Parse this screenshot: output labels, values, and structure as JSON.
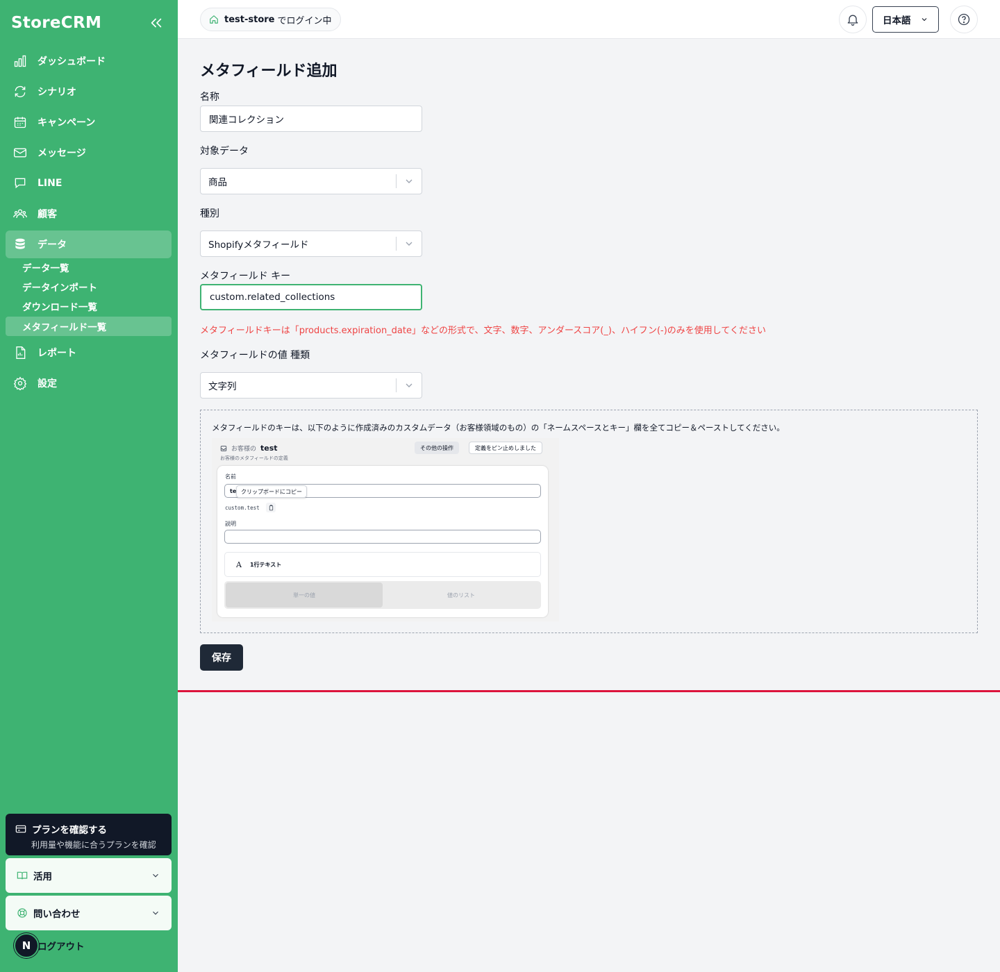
{
  "sidebar": {
    "brand": "StoreCRM",
    "items": [
      {
        "label": "ダッシュボード",
        "icon": "bar-chart-icon"
      },
      {
        "label": "シナリオ",
        "icon": "refresh-icon"
      },
      {
        "label": "キャンペーン",
        "icon": "calendar-icon"
      },
      {
        "label": "メッセージ",
        "icon": "mail-icon"
      },
      {
        "label": "LINE",
        "icon": "chat-icon"
      },
      {
        "label": "顧客",
        "icon": "users-icon"
      },
      {
        "label": "データ",
        "icon": "database-icon",
        "active": true
      },
      {
        "label": "レポート",
        "icon": "report-icon"
      },
      {
        "label": "設定",
        "icon": "gear-icon"
      }
    ],
    "sub_items": [
      {
        "label": "データ一覧"
      },
      {
        "label": "データインポート"
      },
      {
        "label": "ダウンロード一覧"
      },
      {
        "label": "メタフィールド一覧",
        "active": true
      }
    ],
    "plan": {
      "title": "プランを確認する",
      "subtitle": "利用量や機能に合うプランを確認"
    },
    "accordions": [
      {
        "label": "活用",
        "icon": "book-icon"
      },
      {
        "label": "問い合わせ",
        "icon": "lifebuoy-icon"
      }
    ],
    "logout": "ログアウト",
    "avatar_letter": "N"
  },
  "topbar": {
    "store_name": "test-store",
    "store_status": "でログイン中",
    "language": "日本語"
  },
  "form": {
    "title": "メタフィールド追加",
    "name_label": "名称",
    "name_value": "関連コレクション",
    "target_label": "対象データ",
    "target_value": "商品",
    "type_label": "種別",
    "type_value": "Shopifyメタフィールド",
    "key_label": "メタフィールド キー",
    "key_value": "custom.related_collections",
    "key_error": "メタフィールドキーは「products.expiration_date」などの形式で、文字、数字、アンダースコア(_)、ハイフン(-)のみを使用してください",
    "value_type_label": "メタフィールドの値 種類",
    "value_type_value": "文字列",
    "hint": "メタフィールドのキーは、以下のように作成済みのカスタムデータ（お客様領域のもの）の「ネームスペースとキー」欄を全てコピー＆ペーストしてください。",
    "save_label": "保存"
  },
  "example": {
    "crumb": "お客様の",
    "crumb_current": "test",
    "crumb_sub": "お客様のメタフィールドの定義",
    "other_actions": "その他の操作",
    "pinned": "定義をピン止めしました",
    "name_label": "名前",
    "name_prefix": "te",
    "tooltip": "クリップボードにコピー",
    "key": "custom.test",
    "desc_label": "説明",
    "type_label": "1行テキスト",
    "single_value": "単一の値",
    "list_value": "値のリスト"
  },
  "colors": {
    "sidebar": "#3eb372",
    "error": "#ef4444",
    "save": "#1f2937",
    "red_line": "#dc143c"
  }
}
